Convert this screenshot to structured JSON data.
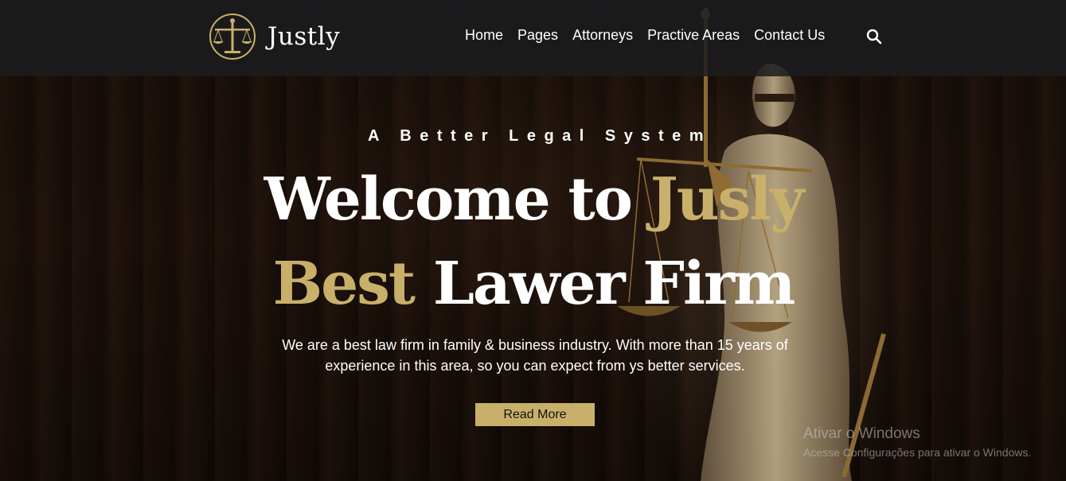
{
  "brand": {
    "name": "Justly"
  },
  "nav": {
    "items": [
      {
        "label": "Home"
      },
      {
        "label": "Pages"
      },
      {
        "label": "Attorneys"
      },
      {
        "label": "Practive Areas"
      },
      {
        "label": "Contact Us"
      }
    ],
    "search_icon": "search-icon"
  },
  "hero": {
    "tagline": "A Better Legal System",
    "headline_line1": {
      "white": "Welcome to ",
      "gold": "Jusly"
    },
    "headline_line2": {
      "gold": "Best",
      "white": " Lawer Firm"
    },
    "description": "We are a best law firm in family & business industry. With more than 15 years of experience in this area, so you can expect from ys better services.",
    "cta_label": "Read More"
  },
  "os_watermark": {
    "title": "Ativar o Windows",
    "subtitle": "Acesse Configurações para ativar o Windows."
  },
  "colors": {
    "accent_gold": "#c9b06a",
    "navbar_bg": "#1c1c1e",
    "text_white": "#ffffff"
  }
}
